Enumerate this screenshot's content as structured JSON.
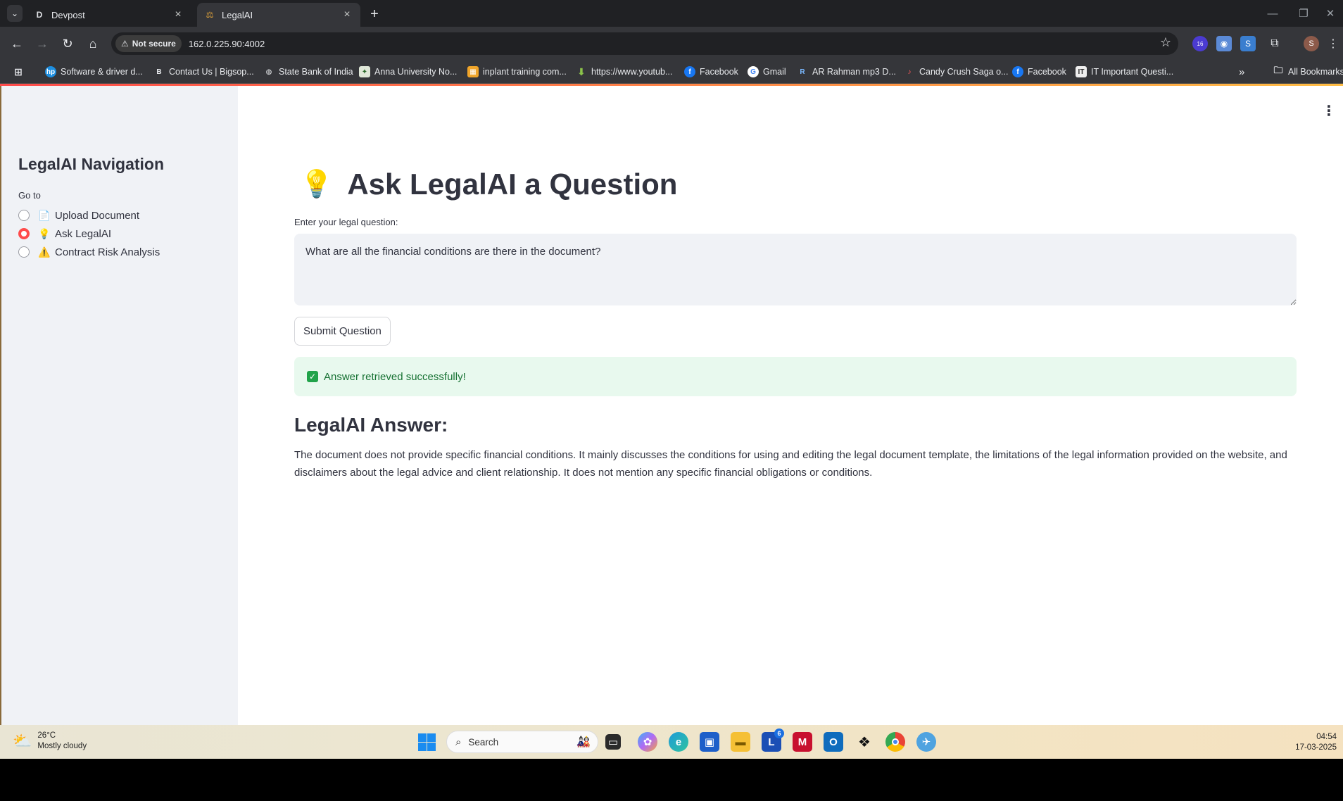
{
  "browser": {
    "tabs": [
      {
        "title": "Devpost",
        "favicon": "D"
      },
      {
        "title": "LegalAI",
        "favicon": "scales-icon"
      }
    ],
    "security_label": "Not secure",
    "url": "162.0.225.90:4002",
    "extension_badge": "16",
    "profile_initial": "S",
    "bookmarks": [
      "Software & driver d...",
      "Contact Us | Bigsop...",
      "State Bank of India",
      "Anna University No...",
      "inplant training com...",
      "https://www.youtub...",
      "Facebook",
      "Gmail",
      "AR Rahman mp3 D...",
      "Candy Crush Saga o...",
      "Facebook",
      "IT Important Questi..."
    ],
    "all_bookmarks": "All Bookmarks"
  },
  "sidebar": {
    "title": "LegalAI Navigation",
    "goto_label": "Go to",
    "options": [
      {
        "label": "Upload Document",
        "icon": "📄",
        "selected": false
      },
      {
        "label": "Ask LegalAI",
        "icon": "💡",
        "selected": true
      },
      {
        "label": "Contract Risk Analysis",
        "icon": "⚠️",
        "selected": false
      }
    ]
  },
  "main": {
    "title_icon": "💡",
    "title": "Ask LegalAI a Question",
    "question_label": "Enter your legal question:",
    "question_value": "What are all the financial conditions are there in the document?",
    "submit_label": "Submit Question",
    "success_message": "Answer retrieved successfully!",
    "answer_heading": "LegalAI Answer:",
    "answer_text": "The document does not provide specific financial conditions. It mainly discusses the conditions for using and editing the legal document template, the limitations of the legal information provided on the website, and disclaimers about the legal advice and client relationship. It does not mention any specific financial obligations or conditions."
  },
  "taskbar": {
    "temperature": "26°C",
    "weather": "Mostly cloudy",
    "search_placeholder": "Search",
    "badge_count": "6",
    "time": "04:54",
    "date": "17-03-2025"
  },
  "colors": {
    "accent": "#ff4b4b",
    "success_bg": "#e8f9ee",
    "success_text": "#177233",
    "sidebar_bg": "#f0f2f6"
  }
}
